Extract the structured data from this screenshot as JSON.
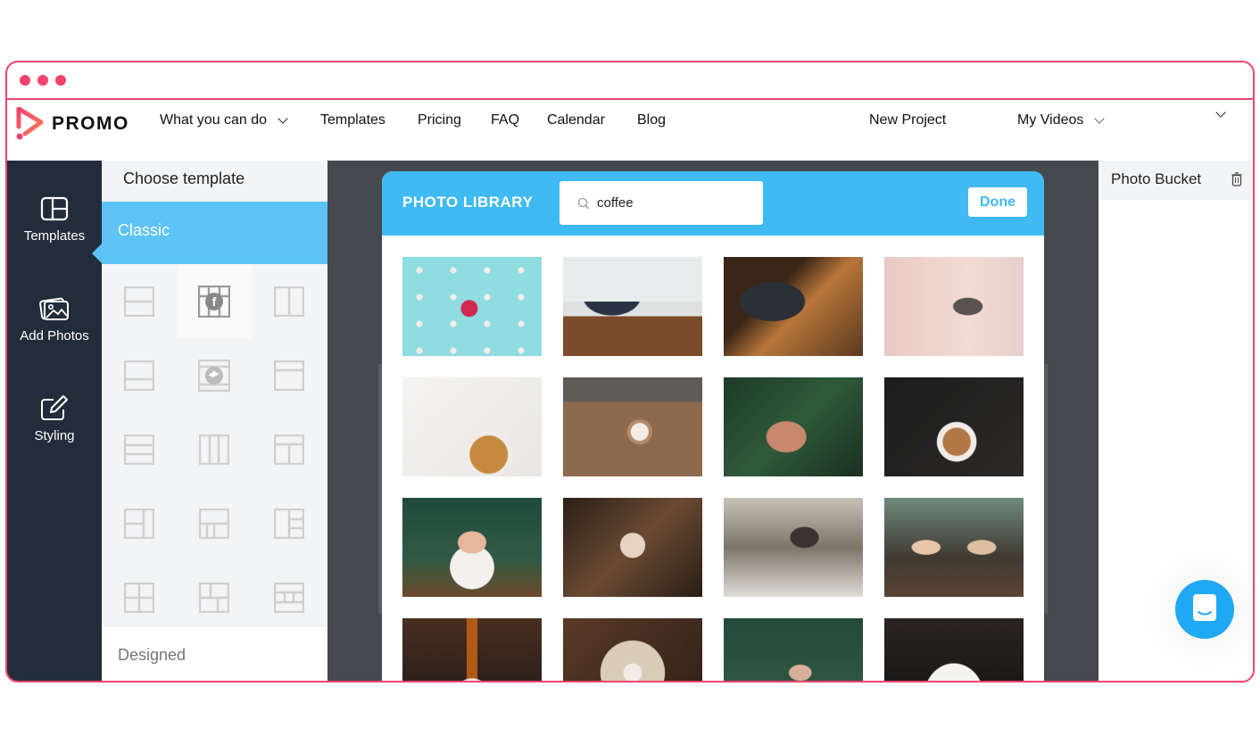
{
  "window": {
    "dots": 3,
    "accent": "#f2436e"
  },
  "nav": {
    "brand": "PROMO",
    "items": [
      {
        "label": "What you can do",
        "dropdown": true
      },
      {
        "label": "Templates",
        "dropdown": false
      },
      {
        "label": "Pricing",
        "dropdown": false
      },
      {
        "label": "FAQ",
        "dropdown": false
      },
      {
        "label": "Calendar",
        "dropdown": false
      },
      {
        "label": "Blog",
        "dropdown": false
      }
    ],
    "new_project": "New Project",
    "my_videos": "My Videos",
    "account_menu_icon": "chevron-down-icon"
  },
  "sidebar": {
    "items": [
      {
        "label": "Templates",
        "icon": "layout-icon",
        "active": true
      },
      {
        "label": "Add Photos",
        "icon": "photos-icon",
        "active": false
      },
      {
        "label": "Styling",
        "icon": "edit-icon",
        "active": false
      }
    ]
  },
  "templates_panel": {
    "title": "Choose template",
    "category_active": "Classic",
    "category_other": "Designed",
    "layouts": [
      "two-rows",
      "facebook",
      "two-columns",
      "top-bottom-wide",
      "twitter",
      "header-body",
      "three-rows",
      "three-columns",
      "header-two-columns",
      "left-split-right",
      "top-three-bottom",
      "left-right-split",
      "quad-grid",
      "mixed-grid",
      "header-three-strip"
    ],
    "selected_layout": "facebook"
  },
  "photo_library": {
    "title": "PHOTO LIBRARY",
    "search_value": "coffee",
    "search_icon": "search-icon",
    "done_label": "Done",
    "photos": [
      {
        "alt": "Rows of white cups with one red cup on teal background"
      },
      {
        "alt": "Father drinking coffee with child at laptop"
      },
      {
        "alt": "Barista handing cup at counter"
      },
      {
        "alt": "Hand holding reusable coffee cup"
      },
      {
        "alt": "Espresso cup with scattered coffee beans on marble"
      },
      {
        "alt": "Hand holding latte art cup on wooden table"
      },
      {
        "alt": "Hand holding coffee beans over greenery"
      },
      {
        "alt": "Pouring latte art into cup"
      },
      {
        "alt": "Smiling woman holding coffee cup in cafe"
      },
      {
        "alt": "Hands holding cappuccino overhead on wood"
      },
      {
        "alt": "Man in cafe reading newspaper with coffee"
      },
      {
        "alt": "Two women chatting at cafe table"
      },
      {
        "alt": "Espresso machine pouring shot"
      },
      {
        "alt": "Hand lifting espresso cup on saucer"
      },
      {
        "alt": "Older man smiling in green cafe"
      },
      {
        "alt": "Espresso pouring into white cup"
      }
    ]
  },
  "photo_bucket": {
    "title": "Photo Bucket",
    "trash_icon": "trash-icon"
  },
  "chat": {
    "icon": "chat-icon",
    "color": "#1fa9f5"
  }
}
